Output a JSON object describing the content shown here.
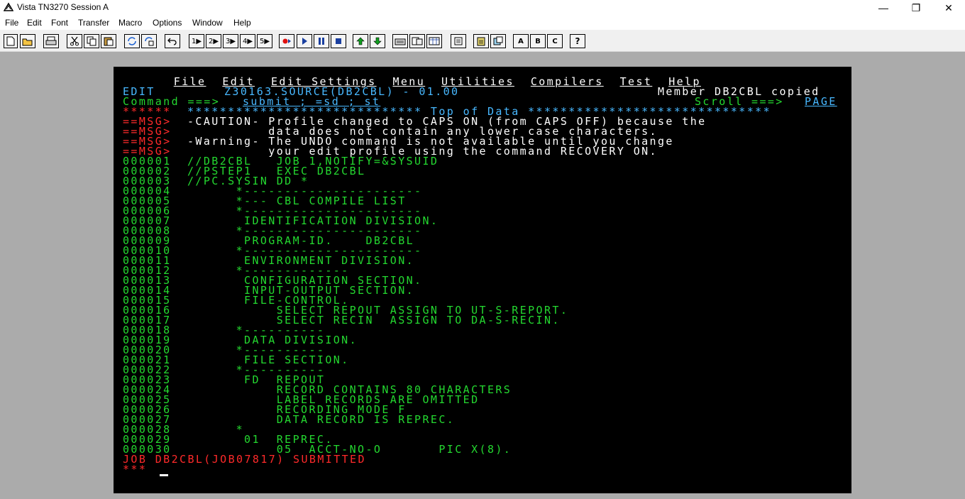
{
  "window": {
    "title": "Vista TN3270 Session A",
    "minimize": "—",
    "maximize": "❐",
    "close": "✕"
  },
  "menu": [
    "File",
    "Edit",
    "Font",
    "Transfer",
    "Macro",
    "Options",
    "Window",
    "Help"
  ],
  "toolbar": {
    "key1": "1",
    "key2": "2",
    "key3": "3",
    "key4": "4",
    "key5": "5",
    "btnA": "A",
    "btnB": "B",
    "btnC": "C",
    "help": "?"
  },
  "ispf": {
    "menu": [
      "File",
      "Edit",
      "Edit_Settings",
      "Menu",
      "Utilities",
      "Compilers",
      "Test",
      "Help"
    ],
    "mode": "EDIT",
    "dataset": "Z30163.SOURCE(DB2CBL) - 01.00",
    "status": "Member DB2CBL copied",
    "command_label": "Command ===>",
    "command": "submit ; =sd ; st",
    "scroll_label": "Scroll ===>",
    "scroll": "PAGE",
    "top_prefix": "******",
    "top_line": "***************************** Top of Data ******************************",
    "messages": [
      {
        "prefix": "==MSG>",
        "text": "-CAUTION- Profile changed to CAPS ON (from CAPS OFF) because the"
      },
      {
        "prefix": "==MSG>",
        "text": "          data does not contain any lower case characters."
      },
      {
        "prefix": "==MSG>",
        "text": "-Warning- The UNDO command is not available until you change"
      },
      {
        "prefix": "==MSG>",
        "text": "          your edit profile using the command RECOVERY ON."
      }
    ],
    "lines": [
      {
        "n": "000001",
        "t": "//DB2CBL   JOB 1,NOTIFY=&SYSUID"
      },
      {
        "n": "000002",
        "t": "//PSTEP1   EXEC DB2CBL"
      },
      {
        "n": "000003",
        "t": "//PC.SYSIN DD *"
      },
      {
        "n": "000004",
        "t": "      *----------------------"
      },
      {
        "n": "000005",
        "t": "      *--- CBL COMPILE LIST"
      },
      {
        "n": "000006",
        "t": "      *----------------------"
      },
      {
        "n": "000007",
        "t": "       IDENTIFICATION DIVISION."
      },
      {
        "n": "000008",
        "t": "      *----------------------"
      },
      {
        "n": "000009",
        "t": "       PROGRAM-ID.    DB2CBL"
      },
      {
        "n": "000010",
        "t": "      *----------------------"
      },
      {
        "n": "000011",
        "t": "       ENVIRONMENT DIVISION."
      },
      {
        "n": "000012",
        "t": "      *-------------"
      },
      {
        "n": "000013",
        "t": "       CONFIGURATION SECTION."
      },
      {
        "n": "000014",
        "t": "       INPUT-OUTPUT SECTION."
      },
      {
        "n": "000015",
        "t": "       FILE-CONTROL."
      },
      {
        "n": "000016",
        "t": "           SELECT REPOUT ASSIGN TO UT-S-REPORT."
      },
      {
        "n": "000017",
        "t": "           SELECT RECIN  ASSIGN TO DA-S-RECIN."
      },
      {
        "n": "000018",
        "t": "      *----------"
      },
      {
        "n": "000019",
        "t": "       DATA DIVISION."
      },
      {
        "n": "000020",
        "t": "      *----------"
      },
      {
        "n": "000021",
        "t": "       FILE SECTION."
      },
      {
        "n": "000022",
        "t": "      *----------"
      },
      {
        "n": "000023",
        "t": "       FD  REPOUT"
      },
      {
        "n": "000024",
        "t": "           RECORD CONTAINS 80 CHARACTERS"
      },
      {
        "n": "000025",
        "t": "           LABEL RECORDS ARE OMITTED"
      },
      {
        "n": "000026",
        "t": "           RECORDING MODE F"
      },
      {
        "n": "000027",
        "t": "           DATA RECORD IS REPREC."
      },
      {
        "n": "000028",
        "t": "      *"
      },
      {
        "n": "000029",
        "t": "       01  REPREC."
      },
      {
        "n": "000030",
        "t": "           05  ACCT-NO-O       PIC X(8)."
      }
    ],
    "job_message": "JOB DB2CBL(JOB07817) SUBMITTED",
    "prompt": "***"
  }
}
